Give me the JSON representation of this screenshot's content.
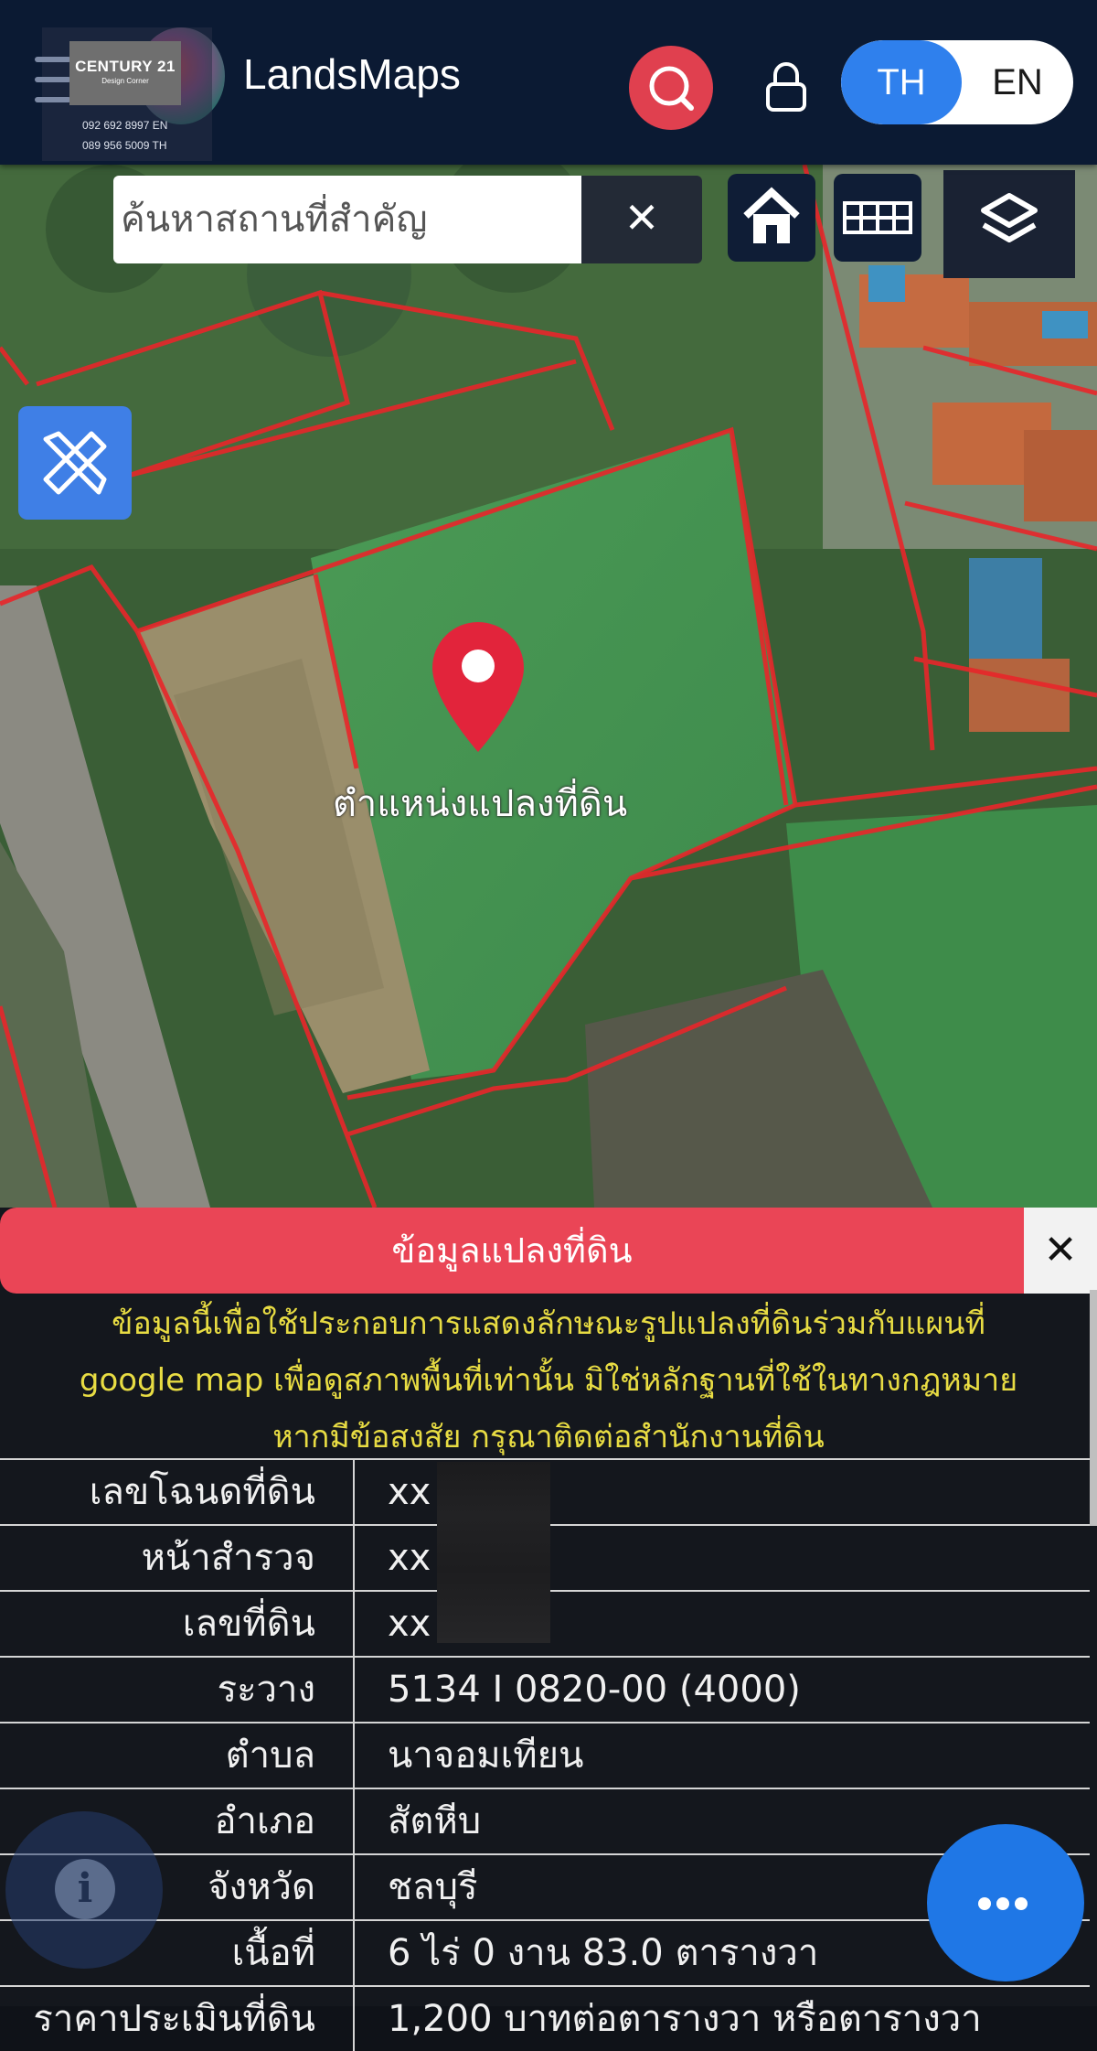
{
  "header": {
    "brand_name": "CENTURY 21",
    "brand_sub": "Design Corner",
    "phone_en": "092 692 8997 EN",
    "phone_th": "089 956 5009 TH",
    "app_title": "LandsMaps",
    "lang_th": "TH",
    "lang_en": "EN",
    "active_lang": "TH"
  },
  "map": {
    "search_placeholder": "ค้นหาสถานที่สำคัญ",
    "clear_label": "✕",
    "pin_label": "ตำแหน่งแปลงที่ดิน"
  },
  "panel": {
    "title": "ข้อมูลแปลงที่ดิน",
    "close_label": "✕",
    "disclaimer_1": "ข้อมูลนี้เพื่อใช้ประกอบการแสดงลักษณะรูปแปลงที่ดินร่วมกับแผนที่",
    "disclaimer_2": "google map เพื่อดูสภาพพื้นที่เท่านั้น มิใช่หลักฐานที่ใช้ในทางกฎหมาย",
    "disclaimer_3": "หากมีข้อสงสัย กรุณาติดต่อสำนักงานที่ดิน",
    "rows": [
      {
        "label": "เลขโฉนดที่ดิน",
        "value": "xx"
      },
      {
        "label": "หน้าสำรวจ",
        "value": "xx"
      },
      {
        "label": "เลขที่ดิน",
        "value": "xx"
      },
      {
        "label": "ระวาง",
        "value": "5134 I 0820-00 (4000)"
      },
      {
        "label": "ตำบล",
        "value": "นาจอมเทียน"
      },
      {
        "label": "อำเภอ",
        "value": "สัตหีบ"
      },
      {
        "label": "จังหวัด",
        "value": "ชลบุรี"
      },
      {
        "label": "เนื้อที่",
        "value": "6 ไร่ 0 งาน 83.0 ตารางวา"
      },
      {
        "label": "ราคาประเมินที่ดิน",
        "value": "1,200 บาทต่อตารางวา หรือตารางวา"
      }
    ]
  },
  "colors": {
    "header_bg": "#0b1a33",
    "accent_red": "#ea4556",
    "accent_blue": "#2f80ed",
    "disclaimer_yellow": "#e8dc43"
  }
}
